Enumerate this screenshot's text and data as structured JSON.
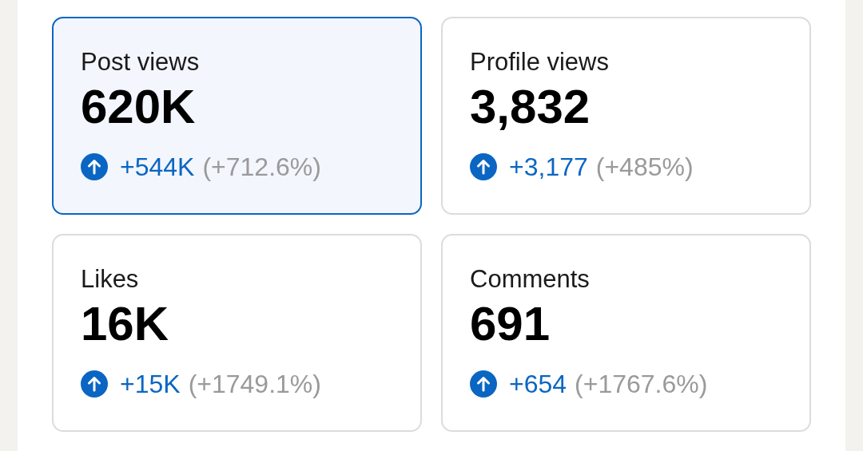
{
  "cards": [
    {
      "title": "Post views",
      "value": "620K",
      "delta": "+544K",
      "percent": "(+712.6%)",
      "selected": true
    },
    {
      "title": "Profile views",
      "value": "3,832",
      "delta": "+3,177",
      "percent": "(+485%)",
      "selected": false
    },
    {
      "title": "Likes",
      "value": "16K",
      "delta": "+15K",
      "percent": "(+1749.1%)",
      "selected": false
    },
    {
      "title": "Comments",
      "value": "691",
      "delta": "+654",
      "percent": "(+1767.6%)",
      "selected": false
    }
  ]
}
